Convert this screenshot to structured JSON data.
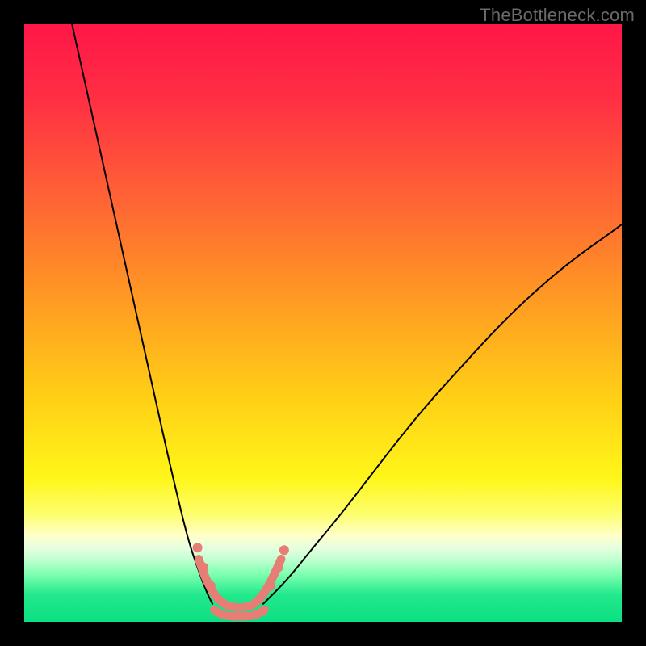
{
  "watermark": "TheBottleneck.com",
  "chart_data": {
    "type": "line",
    "title": "",
    "xlabel": "",
    "ylabel": "",
    "xlim": [
      0,
      100
    ],
    "ylim": [
      0,
      100
    ],
    "grid": false,
    "legend": false,
    "background_gradient_stops": [
      {
        "offset": 0.0,
        "color": "#ff1748"
      },
      {
        "offset": 0.12,
        "color": "#ff2e44"
      },
      {
        "offset": 0.28,
        "color": "#ff5f36"
      },
      {
        "offset": 0.45,
        "color": "#ff9724"
      },
      {
        "offset": 0.62,
        "color": "#ffce16"
      },
      {
        "offset": 0.76,
        "color": "#fff619"
      },
      {
        "offset": 0.82,
        "color": "#fdfe6e"
      },
      {
        "offset": 0.855,
        "color": "#ffffc8"
      },
      {
        "offset": 0.875,
        "color": "#e8ffe0"
      },
      {
        "offset": 0.895,
        "color": "#c3ffd2"
      },
      {
        "offset": 0.92,
        "color": "#7effb0"
      },
      {
        "offset": 0.955,
        "color": "#22e98c"
      },
      {
        "offset": 1.0,
        "color": "#0be083"
      }
    ],
    "series": [
      {
        "name": "left-branch",
        "color": "#000000",
        "width": 2,
        "x": [
          8,
          10,
          12,
          14,
          16,
          18,
          20,
          22,
          24,
          26,
          27.5,
          29,
          30.5,
          31.5
        ],
        "y": [
          100,
          91,
          82,
          73,
          64,
          55,
          46,
          37,
          28,
          19.5,
          13.5,
          9,
          5,
          3
        ]
      },
      {
        "name": "right-branch",
        "color": "#000000",
        "width": 2,
        "x": [
          40,
          44,
          48,
          53,
          58,
          63,
          68,
          73,
          78,
          83,
          88,
          93,
          98,
          100
        ],
        "y": [
          3,
          7,
          12,
          18,
          24.5,
          31,
          37,
          42.5,
          48,
          53,
          57.5,
          61.5,
          65,
          66.5
        ]
      },
      {
        "name": "valley-outline-upper",
        "color": "#e77e75",
        "width": 10.5,
        "x": [
          29.2,
          30.2,
          31.3,
          32.4,
          34,
          36,
          38,
          39.4,
          40.6,
          41.8,
          43.0
        ],
        "y": [
          10.5,
          7.6,
          5.4,
          3.8,
          2.6,
          2.3,
          2.6,
          3.8,
          5.5,
          7.8,
          10.5
        ]
      },
      {
        "name": "valley-outline-lower",
        "color": "#e77e75",
        "width": 10.5,
        "x": [
          31.8,
          33,
          34.5,
          36,
          37.5,
          39,
          40.2
        ],
        "y": [
          2.0,
          1.2,
          0.9,
          0.9,
          0.9,
          1.2,
          2.0
        ]
      }
    ],
    "dots": [
      {
        "x": 29.0,
        "y": 12.4,
        "r": 6.0,
        "color": "#e77e75"
      },
      {
        "x": 30.0,
        "y": 9.1,
        "r": 6.0,
        "color": "#e77e75"
      },
      {
        "x": 31.2,
        "y": 6.0,
        "r": 6.0,
        "color": "#e77e75"
      },
      {
        "x": 41.2,
        "y": 6.0,
        "r": 6.0,
        "color": "#e77e75"
      },
      {
        "x": 42.5,
        "y": 9.1,
        "r": 6.0,
        "color": "#e77e75"
      },
      {
        "x": 43.5,
        "y": 12.0,
        "r": 6.0,
        "color": "#e77e75"
      }
    ]
  }
}
